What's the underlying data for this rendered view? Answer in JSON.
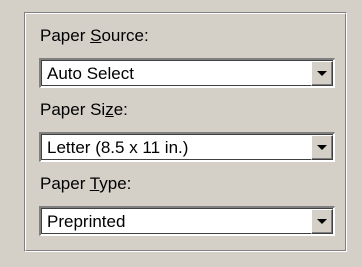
{
  "paper_source": {
    "label_pre": "Paper ",
    "label_accel": "S",
    "label_post": "ource:",
    "value": "Auto Select"
  },
  "paper_size": {
    "label_pre": "Paper Si",
    "label_accel": "z",
    "label_post": "e:",
    "value": "Letter (8.5 x 11 in.)"
  },
  "paper_type": {
    "label_pre": "Paper ",
    "label_accel": "T",
    "label_post": "ype:",
    "value": "Preprinted"
  },
  "icons": {
    "dropdown": "chevron-down-icon"
  }
}
